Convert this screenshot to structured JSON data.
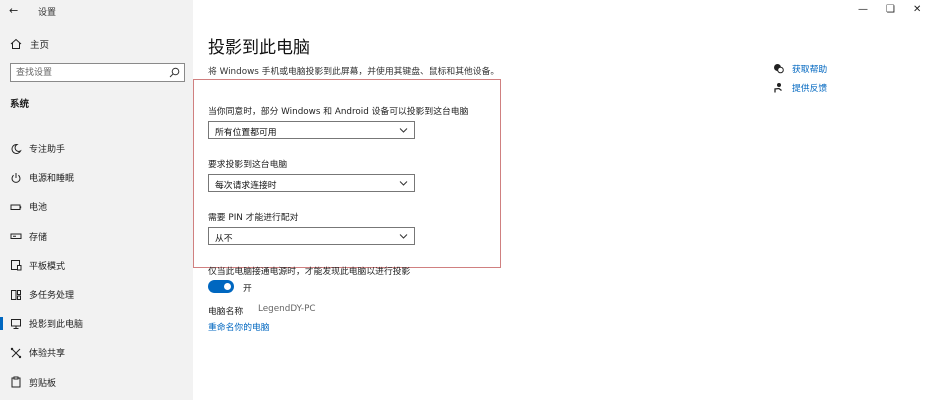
{
  "window": {
    "title": "设置"
  },
  "sidebar": {
    "home_label": "主页",
    "search_placeholder": "查找设置",
    "section_title": "系统",
    "items": [
      {
        "label": "专注助手",
        "icon": "moon-icon"
      },
      {
        "label": "电源和睡眠",
        "icon": "power-icon"
      },
      {
        "label": "电池",
        "icon": "battery-icon"
      },
      {
        "label": "存储",
        "icon": "storage-icon"
      },
      {
        "label": "平板模式",
        "icon": "tablet-icon"
      },
      {
        "label": "多任务处理",
        "icon": "multitask-icon"
      },
      {
        "label": "投影到此电脑",
        "icon": "projection-icon",
        "active": true
      },
      {
        "label": "体验共享",
        "icon": "share-icon"
      },
      {
        "label": "剪贴板",
        "icon": "clipboard-icon"
      }
    ]
  },
  "main": {
    "title": "投影到此电脑",
    "description": "将 Windows 手机或电脑投影到此屏幕，并使用其键盘、鼠标和其他设备。",
    "availability": {
      "label": "当你同意时，部分 Windows 和 Android 设备可以投影到这台电脑",
      "value": "所有位置都可用"
    },
    "ask_to_project": {
      "label": "要求投影到这台电脑",
      "value": "每次请求连接时"
    },
    "require_pin": {
      "label": "需要 PIN 才能进行配对",
      "value": "从不"
    },
    "power_note": "仅当此电脑接通电源时，才能发现此电脑以进行投影",
    "toggle": {
      "state_label": "开",
      "on": true
    },
    "pc_name_label": "电脑名称",
    "pc_name_value": "LegendDY-PC",
    "rename_link": "重命名你的电脑"
  },
  "side_links": {
    "help": "获取帮助",
    "feedback": "提供反馈"
  },
  "colors": {
    "accent": "#0067c0",
    "sidebar_bg": "#f2f2f2",
    "highlight_border": "#d08080"
  }
}
